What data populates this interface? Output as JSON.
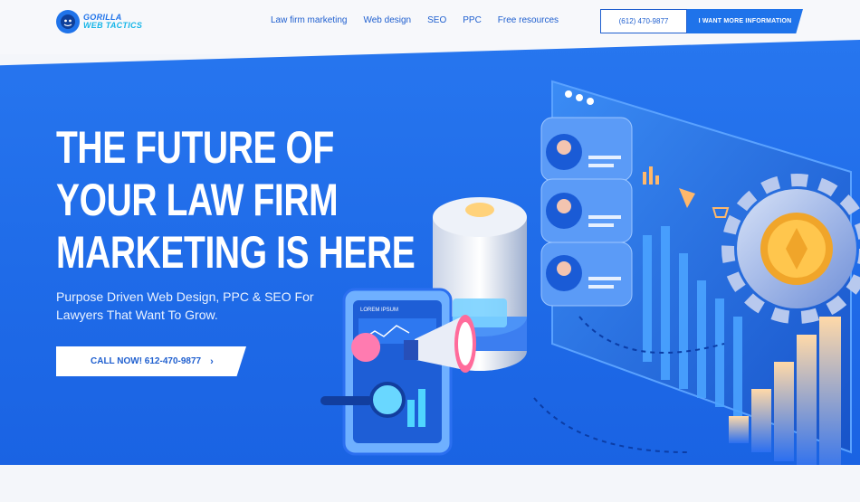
{
  "brand": {
    "logo_line1": "GORILLA",
    "logo_line2": "WEB TACTICS",
    "primary_color": "#1f73ea",
    "accent_color": "#17b6e8"
  },
  "nav": {
    "items": [
      {
        "label": "Law firm marketing"
      },
      {
        "label": "Web design"
      },
      {
        "label": "SEO"
      },
      {
        "label": "PPC"
      },
      {
        "label": "Free resources"
      }
    ]
  },
  "header_actions": {
    "phone_label": "(612) 470-9877",
    "info_label": "I WANT MORE INFORMATION"
  },
  "hero": {
    "headline_lines": [
      "THE FUTURE OF",
      "YOUR LAW FIRM",
      "MARKETING IS HERE"
    ],
    "subtext": "Purpose Driven Web Design, PPC & SEO For Lawyers That Want To Grow.",
    "cta_label": "CALL NOW! 612-470-9877",
    "cta_icon": "chevron-right-icon"
  },
  "illustration": {
    "phone_card_label": "LOREM IPSUM"
  }
}
